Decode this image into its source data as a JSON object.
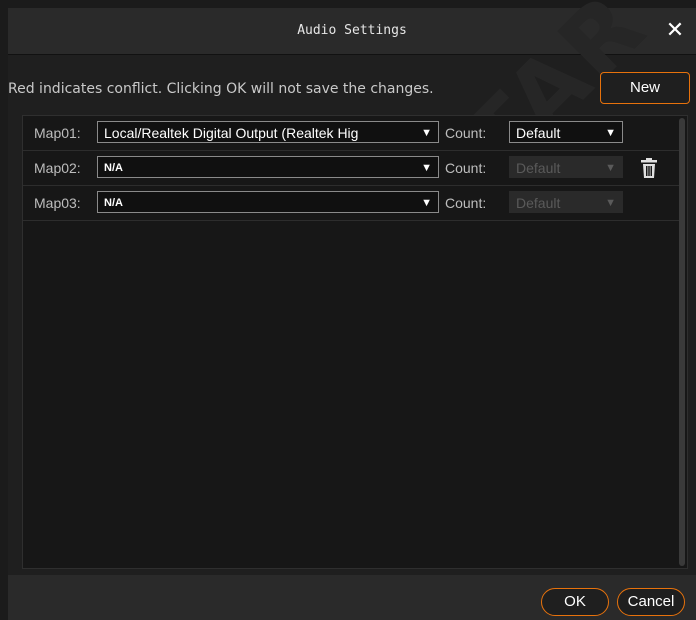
{
  "window": {
    "title": "Audio Settings",
    "close_icon": "close-icon"
  },
  "hint": "Red indicates conflict. Clicking OK will not save the changes.",
  "buttons": {
    "new_label": "New",
    "ok_label": "OK",
    "cancel_label": "Cancel"
  },
  "count_label": "Count:",
  "rows": [
    {
      "label": "Map01:",
      "device": "Local/Realtek Digital Output (Realtek Hig",
      "count": "Default",
      "count_enabled": true,
      "has_delete": false
    },
    {
      "label": "Map02:",
      "device": "N/A",
      "count": "Default",
      "count_enabled": false,
      "has_delete": true
    },
    {
      "label": "Map03:",
      "device": "N/A",
      "count": "Default",
      "count_enabled": false,
      "has_delete": false
    }
  ],
  "watermark": "NOVASTAR",
  "colors": {
    "accent": "#e7720c",
    "background": "#1b1b1b"
  }
}
